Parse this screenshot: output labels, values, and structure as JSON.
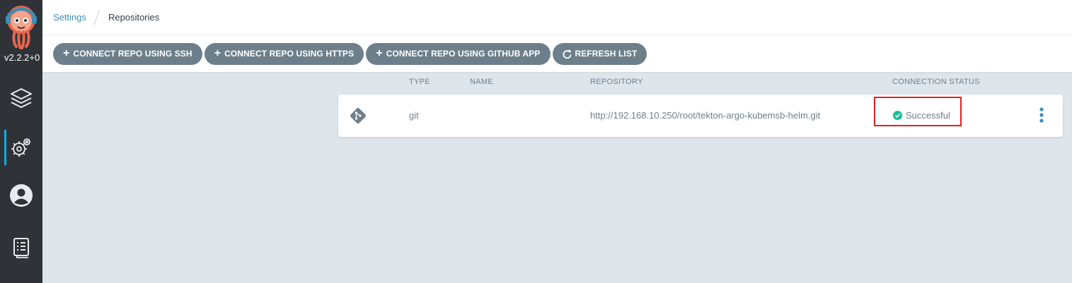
{
  "app": {
    "version": "v2.2.2+0"
  },
  "sidebar": {
    "items": [
      {
        "name": "applications",
        "icon": "layers-icon"
      },
      {
        "name": "settings",
        "icon": "gear-icon",
        "active": true
      },
      {
        "name": "user-info",
        "icon": "user-icon"
      },
      {
        "name": "documentation",
        "icon": "docs-icon"
      }
    ]
  },
  "breadcrumb": {
    "parent": "Settings",
    "current": "Repositories"
  },
  "toolbar": {
    "ssh_label": "CONNECT REPO USING SSH",
    "https_label": "CONNECT REPO USING HTTPS",
    "github_label": "CONNECT REPO USING GITHUB APP",
    "refresh_label": "REFRESH LIST"
  },
  "table": {
    "headers": {
      "type": "TYPE",
      "name": "NAME",
      "repository": "REPOSITORY",
      "status": "CONNECTION STATUS"
    },
    "rows": [
      {
        "type": "git",
        "name": "",
        "repository": "http://192.168.10.250/root/tekton-argo-kubemsb-helm.git",
        "status": "Successful"
      }
    ]
  },
  "colors": {
    "accent": "#3a8fb5",
    "button": "#6d7f8b",
    "success": "#18be94",
    "highlight": "#e02020",
    "sidebar": "#2f3338"
  }
}
